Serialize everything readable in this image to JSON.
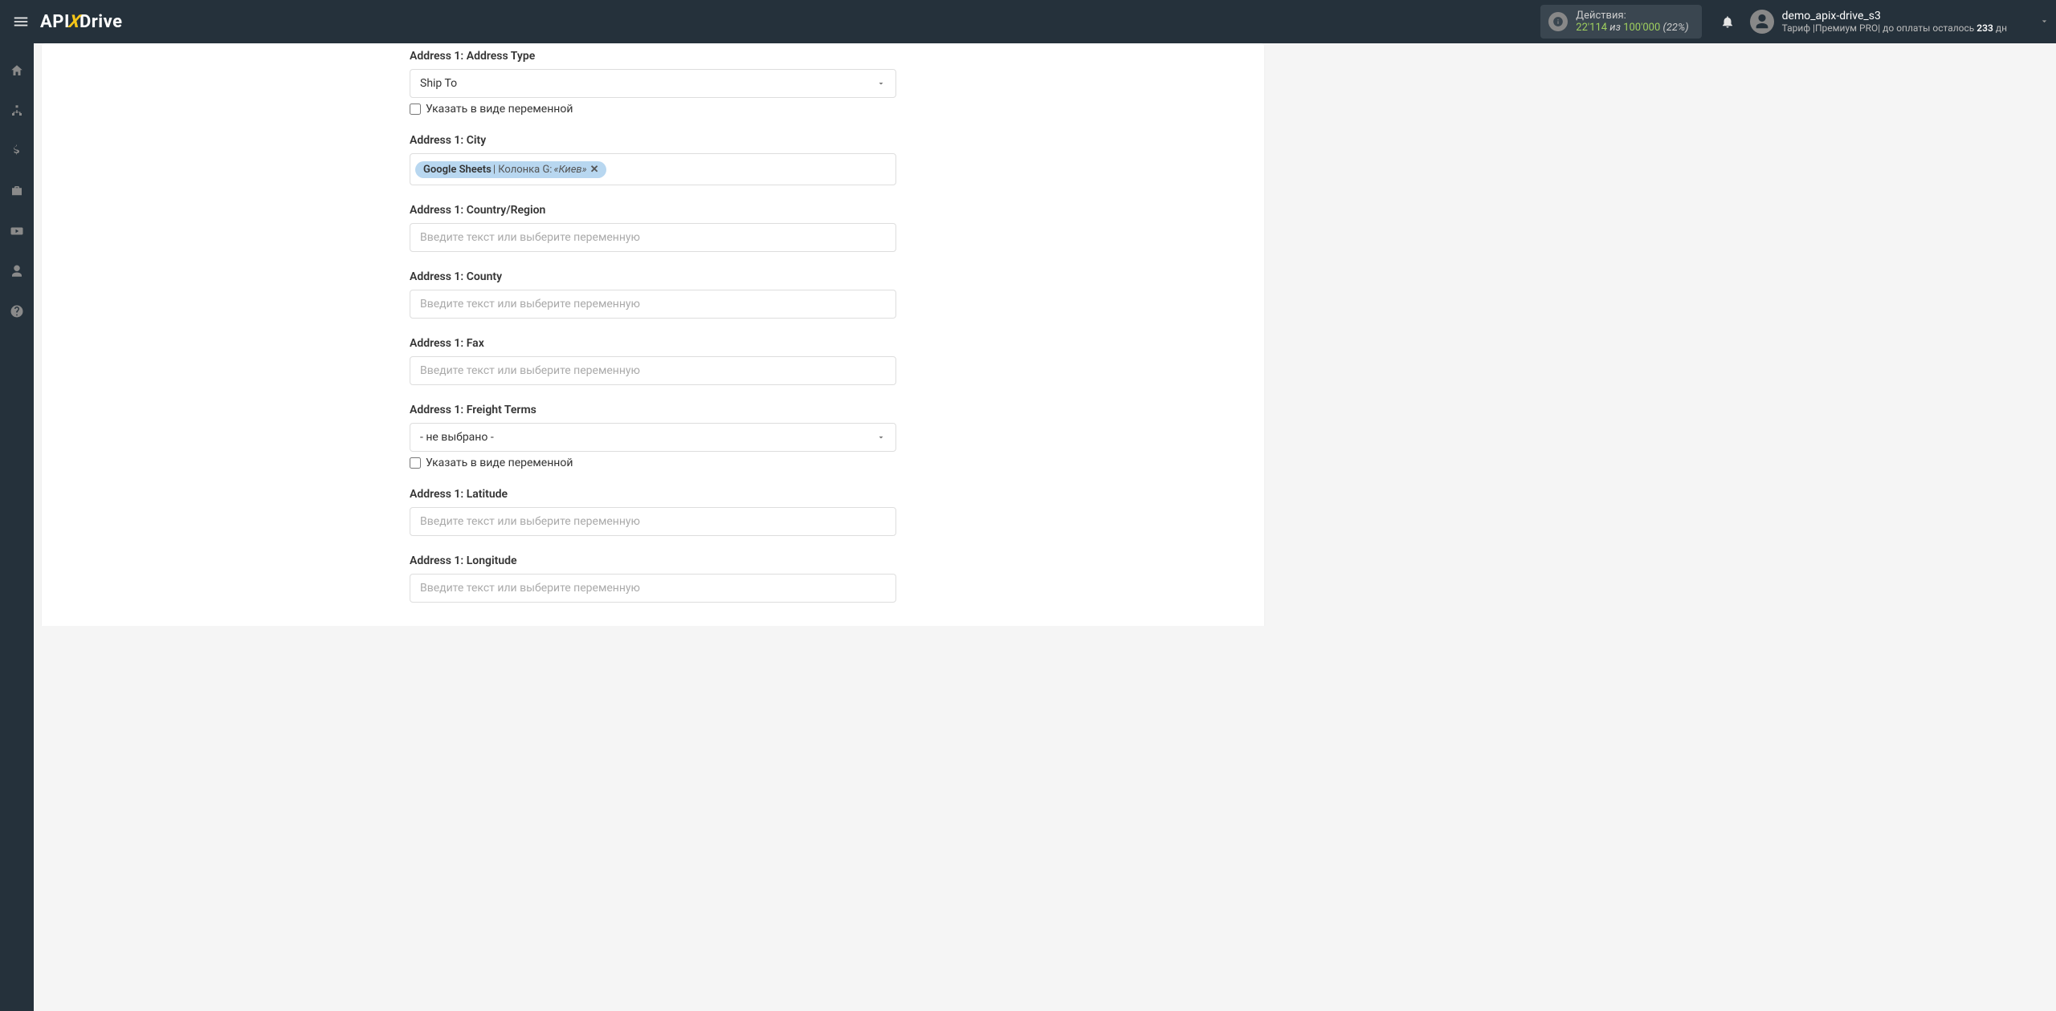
{
  "header": {
    "logo_pre": "API",
    "logo_mid": "X",
    "logo_post": "Drive",
    "actions": {
      "title": "Действия:",
      "used": "22'114",
      "iz": " из ",
      "total": "100'000",
      "pct": "(22%)"
    },
    "user": {
      "name": "demo_apix-drive_s3",
      "tariff_pre": "Тариф |Премиум PRO| до оплаты осталось ",
      "tariff_days": "233",
      "tariff_post": " дн"
    }
  },
  "form": {
    "placeholder": "Введите текст или выберите переменную",
    "variable_checkbox": "Указать в виде переменной",
    "not_selected": "- не выбрано -",
    "address_type": {
      "label": "Address 1: Address Type",
      "value": "Ship To"
    },
    "city": {
      "label": "Address 1: City",
      "pill_source": "Google Sheets",
      "pill_col": " | Колонка G: ",
      "pill_val": "«Киев»"
    },
    "country": {
      "label": "Address 1: Country/Region"
    },
    "county": {
      "label": "Address 1: County"
    },
    "fax": {
      "label": "Address 1: Fax"
    },
    "freight": {
      "label": "Address 1: Freight Terms"
    },
    "latitude": {
      "label": "Address 1: Latitude"
    },
    "longitude": {
      "label": "Address 1: Longitude"
    }
  }
}
